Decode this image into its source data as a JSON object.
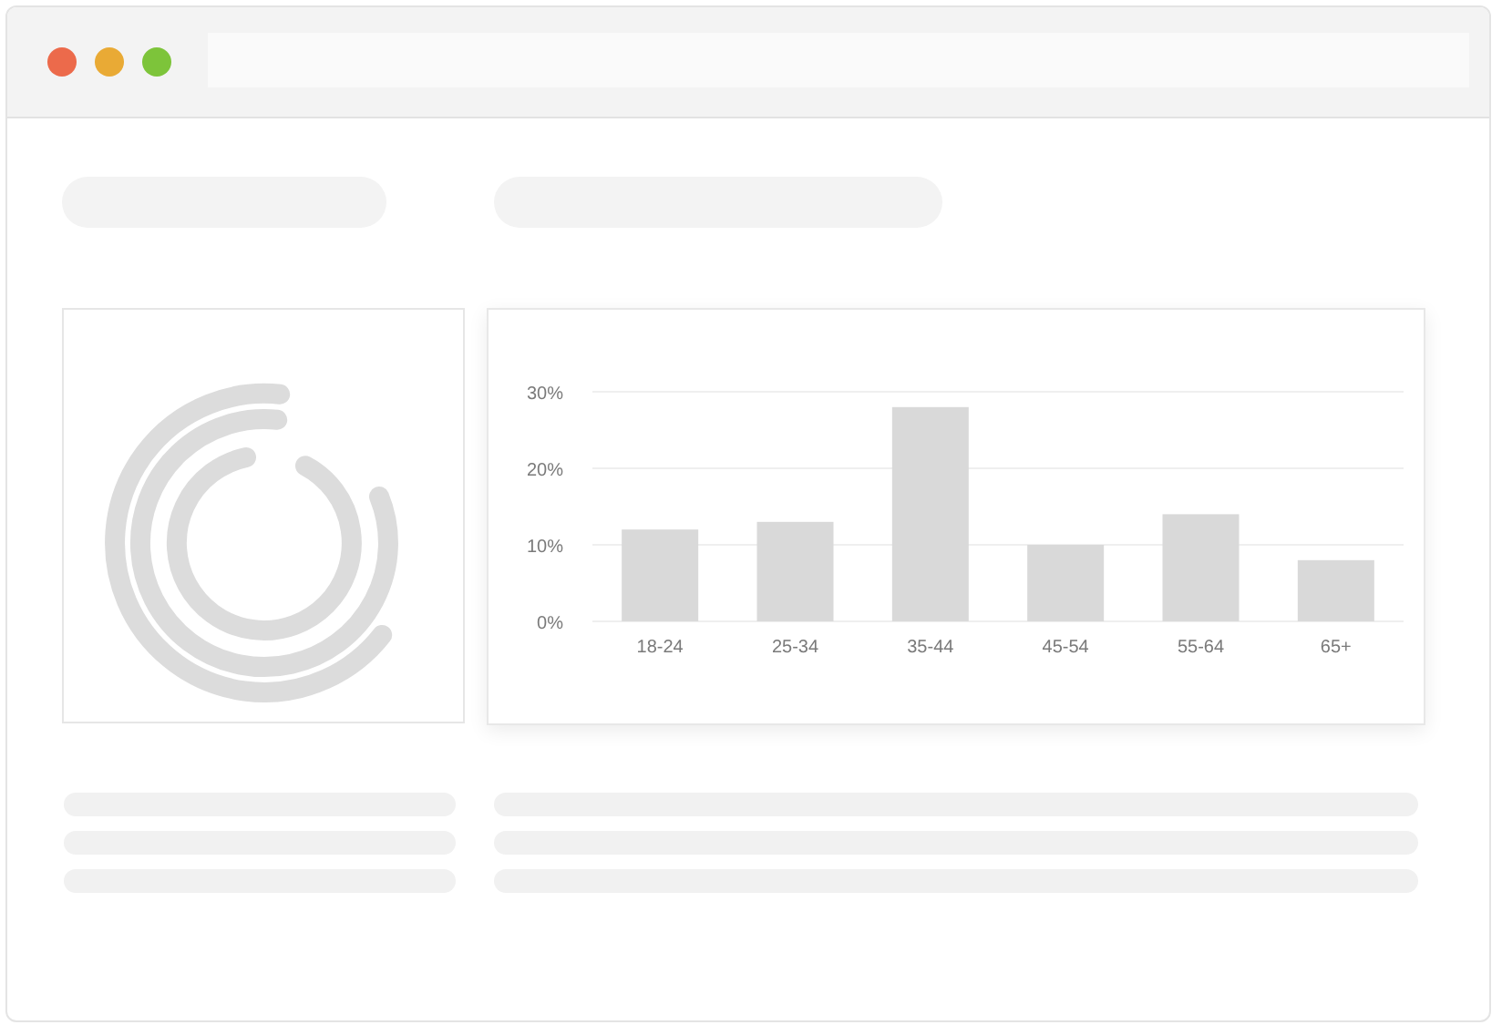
{
  "chart": {
    "chart_data": {
      "type": "bar",
      "categories": [
        "18-24",
        "25-34",
        "35-44",
        "45-54",
        "55-64",
        "65+"
      ],
      "values": [
        12,
        13,
        28,
        10,
        14,
        8
      ],
      "ylim": [
        0,
        30
      ],
      "yticks": [
        {
          "value": 0,
          "label": "0%"
        },
        {
          "value": 10,
          "label": "10%"
        },
        {
          "value": 20,
          "label": "20%"
        },
        {
          "value": 30,
          "label": "30%"
        }
      ]
    }
  }
}
